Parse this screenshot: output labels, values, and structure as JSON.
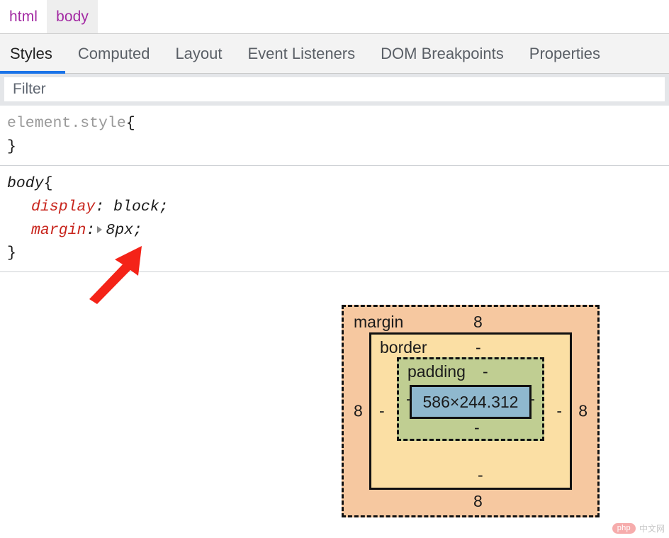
{
  "breadcrumb": {
    "items": [
      {
        "label": "html",
        "selected": false
      },
      {
        "label": "body",
        "selected": true
      }
    ]
  },
  "tabs": [
    {
      "label": "Styles",
      "active": true
    },
    {
      "label": "Computed",
      "active": false
    },
    {
      "label": "Layout",
      "active": false
    },
    {
      "label": "Event Listeners",
      "active": false
    },
    {
      "label": "DOM Breakpoints",
      "active": false
    },
    {
      "label": "Properties",
      "active": false
    }
  ],
  "filter": {
    "placeholder": "Filter",
    "value": ""
  },
  "styles": {
    "rules": [
      {
        "selector": "element.style",
        "open_brace": "{",
        "close_brace": "}",
        "declarations": []
      },
      {
        "selector": "body",
        "open_brace": "{",
        "close_brace": "}",
        "declarations": [
          {
            "property": "display",
            "colon": ":",
            "value": "block",
            "semicolon": ";",
            "expandable": false
          },
          {
            "property": "margin",
            "colon": ":",
            "value": "8px",
            "semicolon": ";",
            "expandable": true
          }
        ]
      }
    ]
  },
  "box_model": {
    "margin": {
      "name": "margin",
      "top": "8",
      "right": "8",
      "bottom": "8",
      "left": "8",
      "color": "#f6c8a0"
    },
    "border": {
      "name": "border",
      "top": "-",
      "right": "-",
      "bottom": "-",
      "left": "-",
      "color": "#fbdfa4"
    },
    "padding": {
      "name": "padding",
      "top": "-",
      "right": "-",
      "bottom": "-",
      "left": "-",
      "color": "#c0ce92"
    },
    "content": {
      "dimensions": "586×244.312",
      "color": "#8fb8ce"
    }
  },
  "annotation": {
    "arrow_color": "#f42318"
  },
  "watermark": {
    "badge": "php",
    "text": "中文网"
  },
  "colors": {
    "accent": "#1a73e8",
    "breadcrumb_text": "#a32aa3",
    "property_red": "#c8241c"
  }
}
